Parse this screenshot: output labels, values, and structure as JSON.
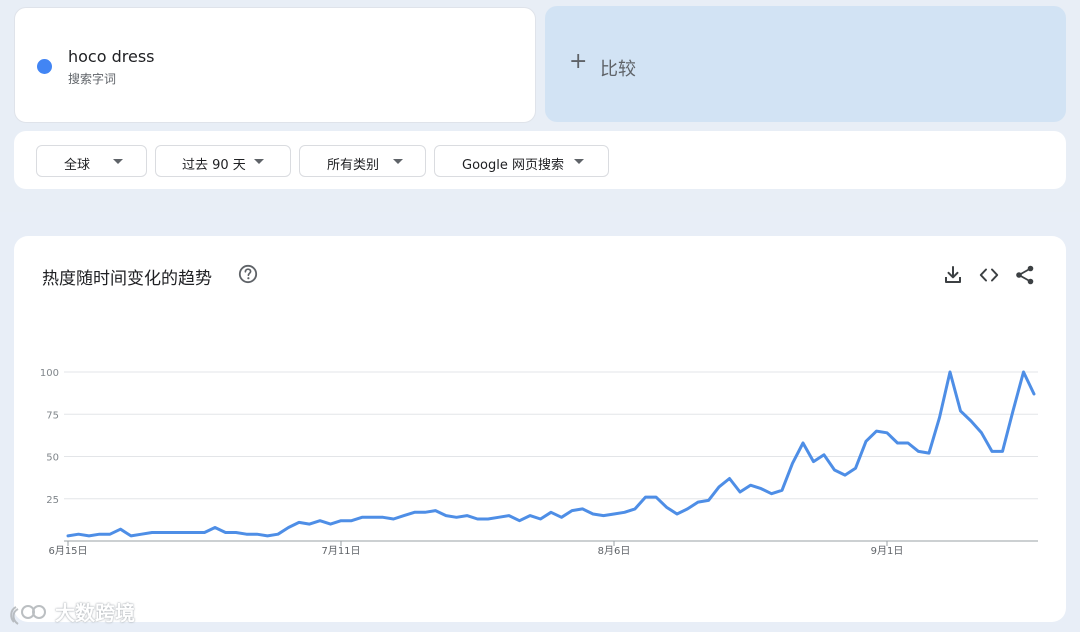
{
  "search_term": {
    "name": "hoco dress",
    "type": "搜索字词",
    "color": "#4285f4"
  },
  "compare": {
    "plus": "+",
    "label": "比较"
  },
  "filters": {
    "region": "全球",
    "time": "过去 90 天",
    "category": "所有类别",
    "search_type": "Google 网页搜索"
  },
  "chart_section": {
    "title": "热度随时间变化的趋势",
    "help_icon": "help-circle-icon",
    "actions": [
      "download-icon",
      "embed-code-icon",
      "share-icon"
    ]
  },
  "chart_data": {
    "type": "line",
    "ylim": [
      0,
      100
    ],
    "yticks": [
      25,
      50,
      75,
      100
    ],
    "xtick_labels": [
      "6月15日",
      "7月11日",
      "8月6日",
      "9月1日"
    ],
    "xtick_index": [
      0,
      26,
      52,
      78
    ],
    "grid": true,
    "line_color": "#4e8ee6",
    "series": [
      {
        "values": [
          3,
          4,
          3,
          4,
          4,
          7,
          3,
          4,
          5,
          5,
          5,
          5,
          5,
          5,
          8,
          5,
          5,
          4,
          4,
          3,
          4,
          8,
          11,
          10,
          12,
          10,
          12,
          12,
          14,
          14,
          14,
          13,
          15,
          17,
          17,
          18,
          15,
          14,
          15,
          13,
          13,
          14,
          15,
          12,
          15,
          13,
          17,
          14,
          18,
          19,
          16,
          15,
          16,
          17,
          19,
          26,
          26,
          20,
          16,
          19,
          23,
          24,
          32,
          37,
          29,
          33,
          31,
          28,
          30,
          46,
          58,
          47,
          51,
          42,
          39,
          43,
          59,
          65,
          64,
          58,
          58,
          53,
          52,
          73,
          100,
          77,
          71,
          64,
          53,
          53,
          77,
          100,
          87
        ]
      }
    ]
  },
  "watermark": {
    "text": "大数跨境",
    "icon": "watermark-logo-icon"
  }
}
